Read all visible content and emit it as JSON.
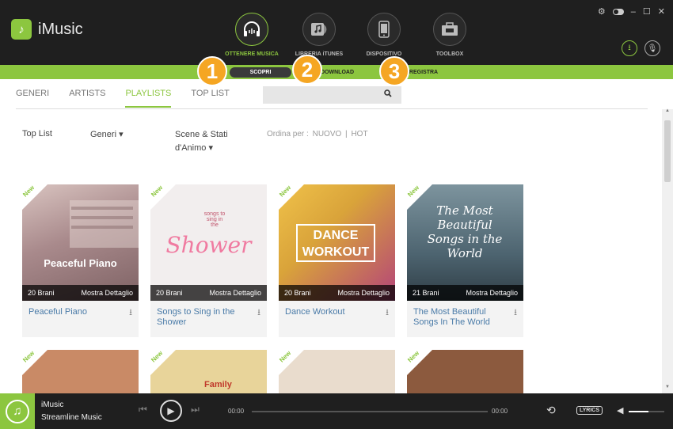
{
  "app": {
    "name": "iMusic"
  },
  "nav": [
    {
      "label": "OTTENERE MUSICA",
      "icon": "headphones-icon",
      "active": true
    },
    {
      "label": "LIBRERIA iTUNES",
      "icon": "music-library-icon",
      "active": false
    },
    {
      "label": "DISPOSITIVO",
      "icon": "phone-icon",
      "active": false
    },
    {
      "label": "TOOLBOX",
      "icon": "toolbox-icon",
      "active": false
    }
  ],
  "subnav": {
    "scopri": "SCOPRI",
    "download": "DOWNLOAD",
    "registra": "REGISTRA"
  },
  "badges": [
    "1",
    "2",
    "3"
  ],
  "tabs": [
    "GENERI",
    "ARTISTS",
    "PLAYLISTS",
    "TOP LIST"
  ],
  "active_tab": "PLAYLISTS",
  "search": {
    "placeholder": ""
  },
  "filters": {
    "toplist": "Top List",
    "generi": "Generi",
    "scene_line1": "Scene & Stati",
    "scene_line2": "d'Animo",
    "sort_label": "Ordina per :",
    "sort_new": "NUOVO",
    "sort_sep": "|",
    "sort_hot": "HOT"
  },
  "new_label": "New",
  "detail_label": "Mostra Dettaglio",
  "playlists": [
    {
      "count": "20 Brani",
      "name": "Peaceful Piano",
      "thumb_text": "Peaceful Piano",
      "color": "#a98a8c"
    },
    {
      "count": "20 Brani",
      "name": "Songs to Sing in the Shower",
      "thumb_text": "Shower",
      "color": "#f2eeee"
    },
    {
      "count": "20 Brani",
      "name": "Dance Workout",
      "thumb_text": "DANCE WORKOUT",
      "color": "#d9a33a"
    },
    {
      "count": "21 Brani",
      "name": "The Most Beautiful Songs In The World",
      "thumb_text": "The Most Beautiful Songs in the World",
      "color": "#4d6470"
    }
  ],
  "row2_colors": [
    "#c98a66",
    "#e8d49a",
    "#e9dccd",
    "#8c5a3e"
  ],
  "row2_text": [
    "",
    "Family",
    "",
    ""
  ],
  "player": {
    "title": "iMusic",
    "artist": "Streamline Music",
    "time_current": "00:00",
    "time_total": "00:00",
    "lyrics": "LYRICS",
    "volume": 0.55
  },
  "colors": {
    "accent": "#8cc63f",
    "badge": "#f5a623",
    "dark": "#1f1f1f"
  }
}
